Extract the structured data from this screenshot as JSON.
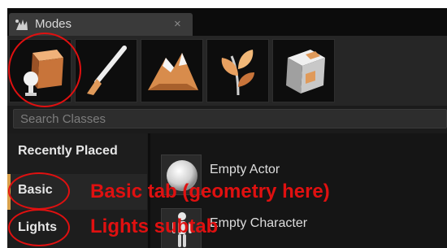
{
  "window": {
    "tab_title": "Modes",
    "tab_close": "×",
    "tab_icon": "modes-hand-icon"
  },
  "modes": [
    {
      "name": "place-mode-icon",
      "selected": true
    },
    {
      "name": "paint-mode-icon",
      "selected": false
    },
    {
      "name": "landscape-mode-icon",
      "selected": false
    },
    {
      "name": "foliage-mode-icon",
      "selected": false
    },
    {
      "name": "geometry-edit-mode-icon",
      "selected": false
    }
  ],
  "search": {
    "placeholder": "Search Classes",
    "value": ""
  },
  "sidebar": {
    "items": [
      {
        "label": "Recently Placed"
      },
      {
        "label": "Basic"
      },
      {
        "label": "Lights"
      }
    ]
  },
  "list": {
    "items": [
      {
        "label": "Empty Actor",
        "icon": "sphere-icon"
      },
      {
        "label": "Empty Character",
        "icon": "mannequin-icon"
      }
    ]
  },
  "annotations": {
    "basic_note": "Basic tab (geometry here)",
    "lights_note": "Lights subtab",
    "color": "#e01010"
  },
  "colors": {
    "panel_bg": "#1b1b1b",
    "tab_bg": "#3a3a3a",
    "accent": "#d8a04a",
    "annotation": "#e01010"
  }
}
